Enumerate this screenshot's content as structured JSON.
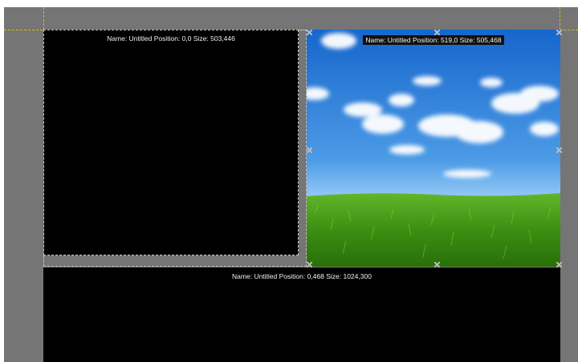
{
  "layers": [
    {
      "id": "layer-1",
      "caption": "Name: Untitled   Position: 0,0   Size: 503,446",
      "fill": "#000000",
      "selected": false
    },
    {
      "id": "layer-2",
      "caption": "Name: Untitled   Position: 519,0   Size: 505,468",
      "fill": "sky-grass-image",
      "selected": true
    },
    {
      "id": "layer-3",
      "caption": "Name: Untitled   Position: 0,468   Size: 1024,300",
      "fill": "#000000",
      "selected": false
    }
  ],
  "colors": {
    "workspace": "#757575",
    "guide": "#d9c200",
    "layer_border": "#cfcfcf",
    "sky_top": "#1a6fd6",
    "sky_bottom": "#bfe3ff",
    "grass": "#3f9a14"
  },
  "icons": [
    "transform-handle-icon"
  ]
}
